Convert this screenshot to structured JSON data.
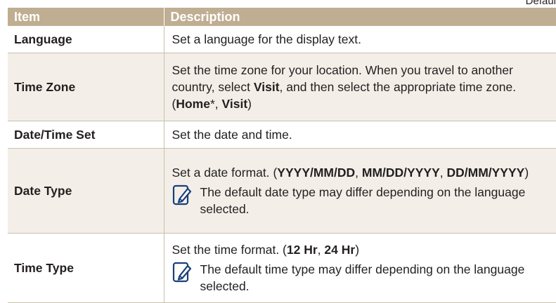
{
  "corner_text": "Defaul",
  "table": {
    "headers": {
      "item": "Item",
      "description": "Description"
    },
    "language": {
      "item": "Language",
      "description": "Set a language for the display text."
    },
    "time_zone": {
      "item": "Time Zone",
      "text_1": "Set the time zone for your location. When you travel to another country, select ",
      "bold_1": "Visit",
      "text_2": ", and then select the appropriate time zone. (",
      "bold_2": "Home",
      "text_3": "*, ",
      "bold_3": "Visit",
      "text_4": ")"
    },
    "date_time_set": {
      "item": "Date/Time Set",
      "description": "Set the date and time."
    },
    "date_type": {
      "item": "Date Type",
      "text_1": "Set a date format. (",
      "bold_1": "YYYY/MM/DD",
      "sep_1": ", ",
      "bold_2": "MM/DD/YYYY",
      "sep_2": ", ",
      "bold_3": "DD/MM/YYYY",
      "text_2": ")",
      "note": "The default date type may differ depending on the language selected.",
      "note_icon": "note-pencil-icon"
    },
    "time_type": {
      "item": "Time Type",
      "text_1": "Set the time format. (",
      "bold_1": "12 Hr",
      "sep_1": ", ",
      "bold_2": "24 Hr",
      "text_2": ")",
      "note": "The default time type may differ depending on the language selected.",
      "note_icon": "note-pencil-icon"
    }
  },
  "colors": {
    "header_bg": "#bfae92",
    "row_shade": "#f3efe8",
    "rule": "#c9bfae",
    "icon": "#1a3f7a"
  }
}
